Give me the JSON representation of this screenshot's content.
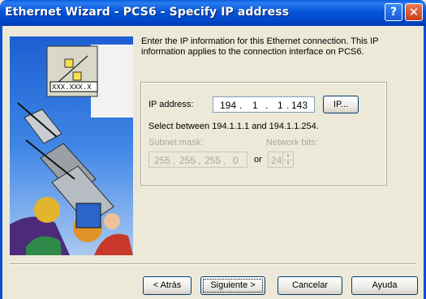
{
  "window": {
    "title": "Ethernet Wizard - PCS6 - Specify IP address"
  },
  "titlebar_buttons": {
    "help_glyph": "?",
    "close_glyph": "✕"
  },
  "illustration": {
    "ip_placeholder": "XXX.XXX.X"
  },
  "intro_text": "Enter the IP information for this Ethernet connection. This IP information applies to the connection interface on PCS6.",
  "ip_section": {
    "ip_label": "IP address:",
    "ip_value": {
      "o1": "194",
      "o2": "1",
      "o3": "1",
      "o4": "143",
      "dot": "."
    },
    "ip_button": "IP...",
    "range_text": "Select between 194.1.1.1 and 194.1.1.254.",
    "subnet_label": "Subnet mask:",
    "subnet_value": {
      "o1": "255",
      "o2": "255",
      "o3": "255",
      "o4": "0"
    },
    "or_label": "or",
    "network_bits_label": "Network bits:",
    "network_bits_value": "24"
  },
  "footer": {
    "back": "< Atrás",
    "next": "Siguiente >",
    "cancel": "Cancelar",
    "help": "Ayuda"
  },
  "colors": {
    "titlebar": "#0655d8",
    "face": "#ece9d8",
    "disabled_text": "#aca899"
  }
}
